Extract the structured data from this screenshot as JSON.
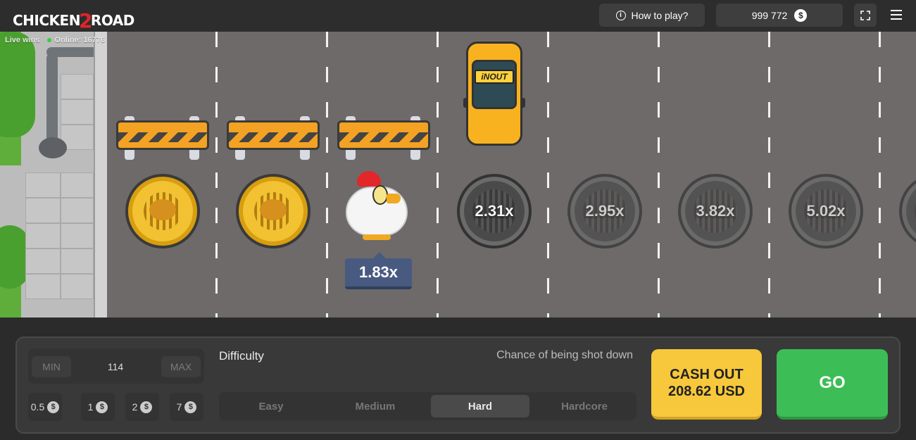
{
  "header": {
    "logo_part1": "CHICKEN",
    "logo_two": "2",
    "logo_part2": "ROAD",
    "how_to_play": "How to play?",
    "balance": "999 772",
    "currency_symbol": "$"
  },
  "live": {
    "live_wins": "Live wins",
    "online": "Online: 16776"
  },
  "road": {
    "current_multiplier": "1.83x",
    "car_sign": "iNOUT",
    "multipliers": [
      "2.31x",
      "2.95x",
      "3.82x",
      "5.02x"
    ]
  },
  "bet": {
    "min_label": "MIN",
    "value": "114",
    "max_label": "MAX",
    "quick": [
      "0.5",
      "1",
      "2",
      "7"
    ]
  },
  "difficulty": {
    "label": "Difficulty",
    "chance_label": "Chance of being shot down",
    "options": [
      "Easy",
      "Medium",
      "Hard",
      "Hardcore"
    ],
    "selected": "Hard"
  },
  "actions": {
    "cashout_line1": "CASH OUT",
    "cashout_line2": "208.62 USD",
    "go": "GO"
  },
  "colors": {
    "cashout": "#f7c83b",
    "go": "#3dbd56",
    "tag": "#485a80",
    "road": "#6e6a69"
  }
}
